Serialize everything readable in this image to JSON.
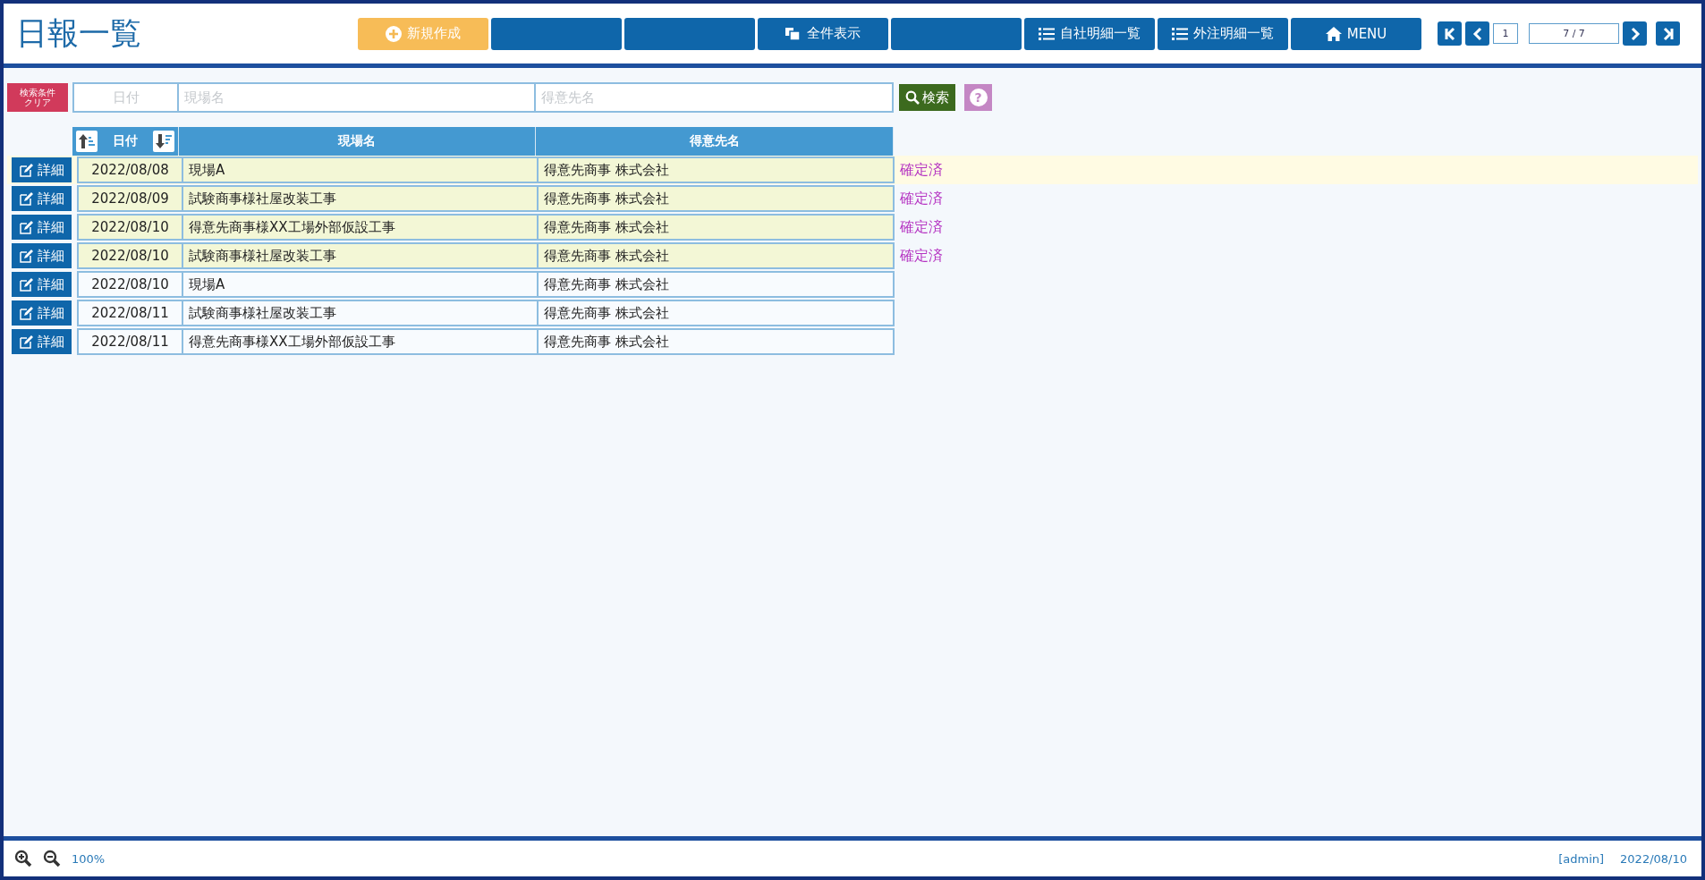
{
  "title": "日報一覧",
  "toolbar": [
    {
      "kind": "new",
      "label": "新規作成"
    },
    {
      "kind": "blank"
    },
    {
      "kind": "blank"
    },
    {
      "kind": "all",
      "label": "全件表示"
    },
    {
      "kind": "blank"
    },
    {
      "kind": "list",
      "label": "自社明細一覧"
    },
    {
      "kind": "list",
      "label": "外注明細一覧"
    },
    {
      "kind": "menu",
      "label": "MENU"
    }
  ],
  "pager": {
    "page": "1",
    "count": "7 / 7"
  },
  "search": {
    "clear_label": "検索条件クリア",
    "date_placeholder": "日付",
    "site_placeholder": "現場名",
    "client_placeholder": "得意先名",
    "search_label": "検索",
    "help_label": "?"
  },
  "table": {
    "columns": [
      "日付",
      "現場名",
      "得意先名"
    ],
    "rows": [
      {
        "date": "2022/08/08",
        "site": "現場A",
        "client": "得意先商事 株式会社",
        "confirmed": true,
        "status": "確定済",
        "selected": true,
        "detail_label": "詳細"
      },
      {
        "date": "2022/08/09",
        "site": "試験商事様社屋改装工事",
        "client": "得意先商事 株式会社",
        "confirmed": true,
        "status": "確定済",
        "selected": false,
        "detail_label": "詳細"
      },
      {
        "date": "2022/08/10",
        "site": "得意先商事様XX工場外部仮設工事",
        "client": "得意先商事 株式会社",
        "confirmed": true,
        "status": "確定済",
        "selected": false,
        "detail_label": "詳細"
      },
      {
        "date": "2022/08/10",
        "site": "試験商事様社屋改装工事",
        "client": "得意先商事 株式会社",
        "confirmed": true,
        "status": "確定済",
        "selected": false,
        "detail_label": "詳細"
      },
      {
        "date": "2022/08/10",
        "site": "現場A",
        "client": "得意先商事 株式会社",
        "confirmed": false,
        "selected": false,
        "detail_label": "詳細"
      },
      {
        "date": "2022/08/11",
        "site": "試験商事様社屋改装工事",
        "client": "得意先商事 株式会社",
        "confirmed": false,
        "selected": false,
        "detail_label": "詳細"
      },
      {
        "date": "2022/08/11",
        "site": "得意先商事様XX工場外部仮設工事",
        "client": "得意先商事 株式会社",
        "confirmed": false,
        "selected": false,
        "detail_label": "詳細"
      }
    ]
  },
  "status_bar": {
    "zoom": "100%",
    "user": "[admin]",
    "date": "2022/08/10"
  }
}
